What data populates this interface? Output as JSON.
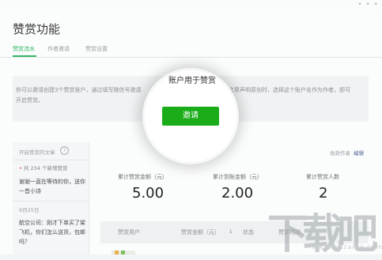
{
  "topbar": {
    "dots": "• • •"
  },
  "page": {
    "title": "赞赏功能"
  },
  "tabs": [
    {
      "label": "赞赏流水",
      "active": true
    },
    {
      "label": "作者邀请",
      "active": false
    },
    {
      "label": "赞赏设置",
      "active": false
    }
  ],
  "notice": {
    "line1_left": "你可以邀请创建3个赞赏账户，通过填写微信号邀请",
    "line1_right": "。你在文章声明原创时，选择这个账户名作为作者，即可",
    "line2": "开启赞赏。"
  },
  "magnifier": {
    "text": "账户用于赞赏",
    "button_label": "邀请",
    "button_color": "#1aad19"
  },
  "sidebar": {
    "header_label": "开启赞赏的文章",
    "help_icon": "?",
    "new_count_text": "共 234 个新增赞赏",
    "new_dot": "•",
    "items": [
      {
        "message": "谢谢一直在等待的你，送你一首小诗"
      },
      {
        "date": "9月25日",
        "message": "航空公司：刚才下单买了架飞机，你们怎么送货，包邮吗？"
      }
    ]
  },
  "main": {
    "link_label": "收款作者",
    "edit_label": "编辑",
    "stats": [
      {
        "label": "累计赞赏金额（元）",
        "value": "5.00"
      },
      {
        "label": "累计到账金额（元）",
        "value": "2.00"
      },
      {
        "label": "累计赞赏人数",
        "value": "2"
      }
    ],
    "table_headers": [
      "赞赏用户",
      "赞赏金额（元）",
      "状态",
      "赞赏时间"
    ],
    "table_header_separator": "↓"
  },
  "watermark": {
    "glyph1": "下",
    "glyph2": "载",
    "glyph3": "吧",
    "sub": "www.xiazaiba.com"
  },
  "colors": {
    "accent": "#33b96a",
    "button_green": "#1aad19",
    "link_blue": "#576b95",
    "alert_red": "#e64340"
  }
}
